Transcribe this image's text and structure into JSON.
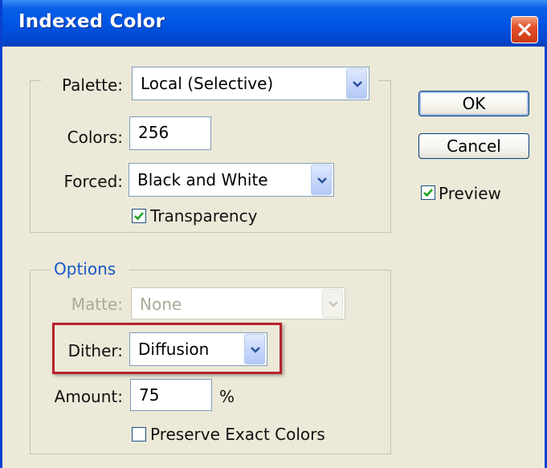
{
  "window": {
    "title": "Indexed Color"
  },
  "palette": {
    "label": "Palette:",
    "value": "Local (Selective)"
  },
  "colors": {
    "label": "Colors:",
    "value": "256"
  },
  "forced": {
    "label": "Forced:",
    "value": "Black and White"
  },
  "transparency": {
    "label": "Transparency",
    "checked": true
  },
  "options": {
    "legend": "Options",
    "matte": {
      "label": "Matte:",
      "value": "None",
      "disabled": true
    },
    "dither": {
      "label": "Dither:",
      "value": "Diffusion"
    },
    "amount": {
      "label": "Amount:",
      "value": "75",
      "unit": "%"
    },
    "preserve": {
      "label": "Preserve Exact Colors",
      "checked": false
    }
  },
  "buttons": {
    "ok": "OK",
    "cancel": "Cancel"
  },
  "preview": {
    "label": "Preview",
    "checked": true
  },
  "colors_theme": {
    "accent": "#0055E5",
    "legend": "#1559C8",
    "highlight": "#B7222A"
  }
}
